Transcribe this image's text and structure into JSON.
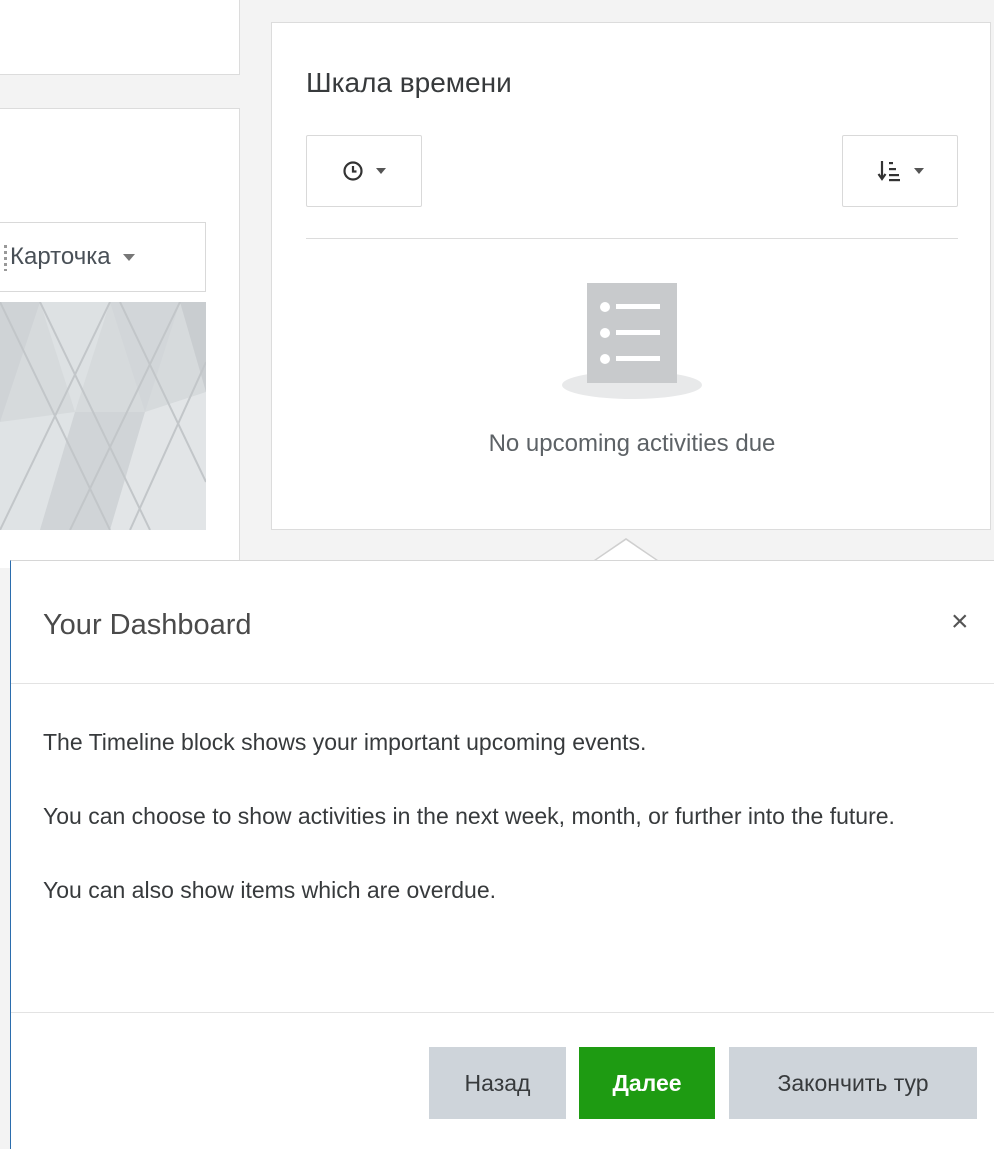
{
  "course_overview": {
    "view_label": "Карточка"
  },
  "timeline": {
    "title": "Шкала времени",
    "empty_text": "No upcoming activities due",
    "time_filter_icon": "clock-icon",
    "sort_icon": "sort-icon"
  },
  "tour": {
    "title": "Your Dashboard",
    "close_label": "×",
    "paragraphs": [
      "The Timeline block shows your important upcoming events.",
      "You can choose to show activities in the next week, month, or further into the future.",
      "You can also show items which are overdue."
    ],
    "buttons": {
      "back": "Назад",
      "next": "Далее",
      "end": "Закончить тур"
    }
  },
  "colors": {
    "next_button": "#1e9b12",
    "secondary_button": "#ced4da",
    "popover_accent": "#2b6dad"
  }
}
